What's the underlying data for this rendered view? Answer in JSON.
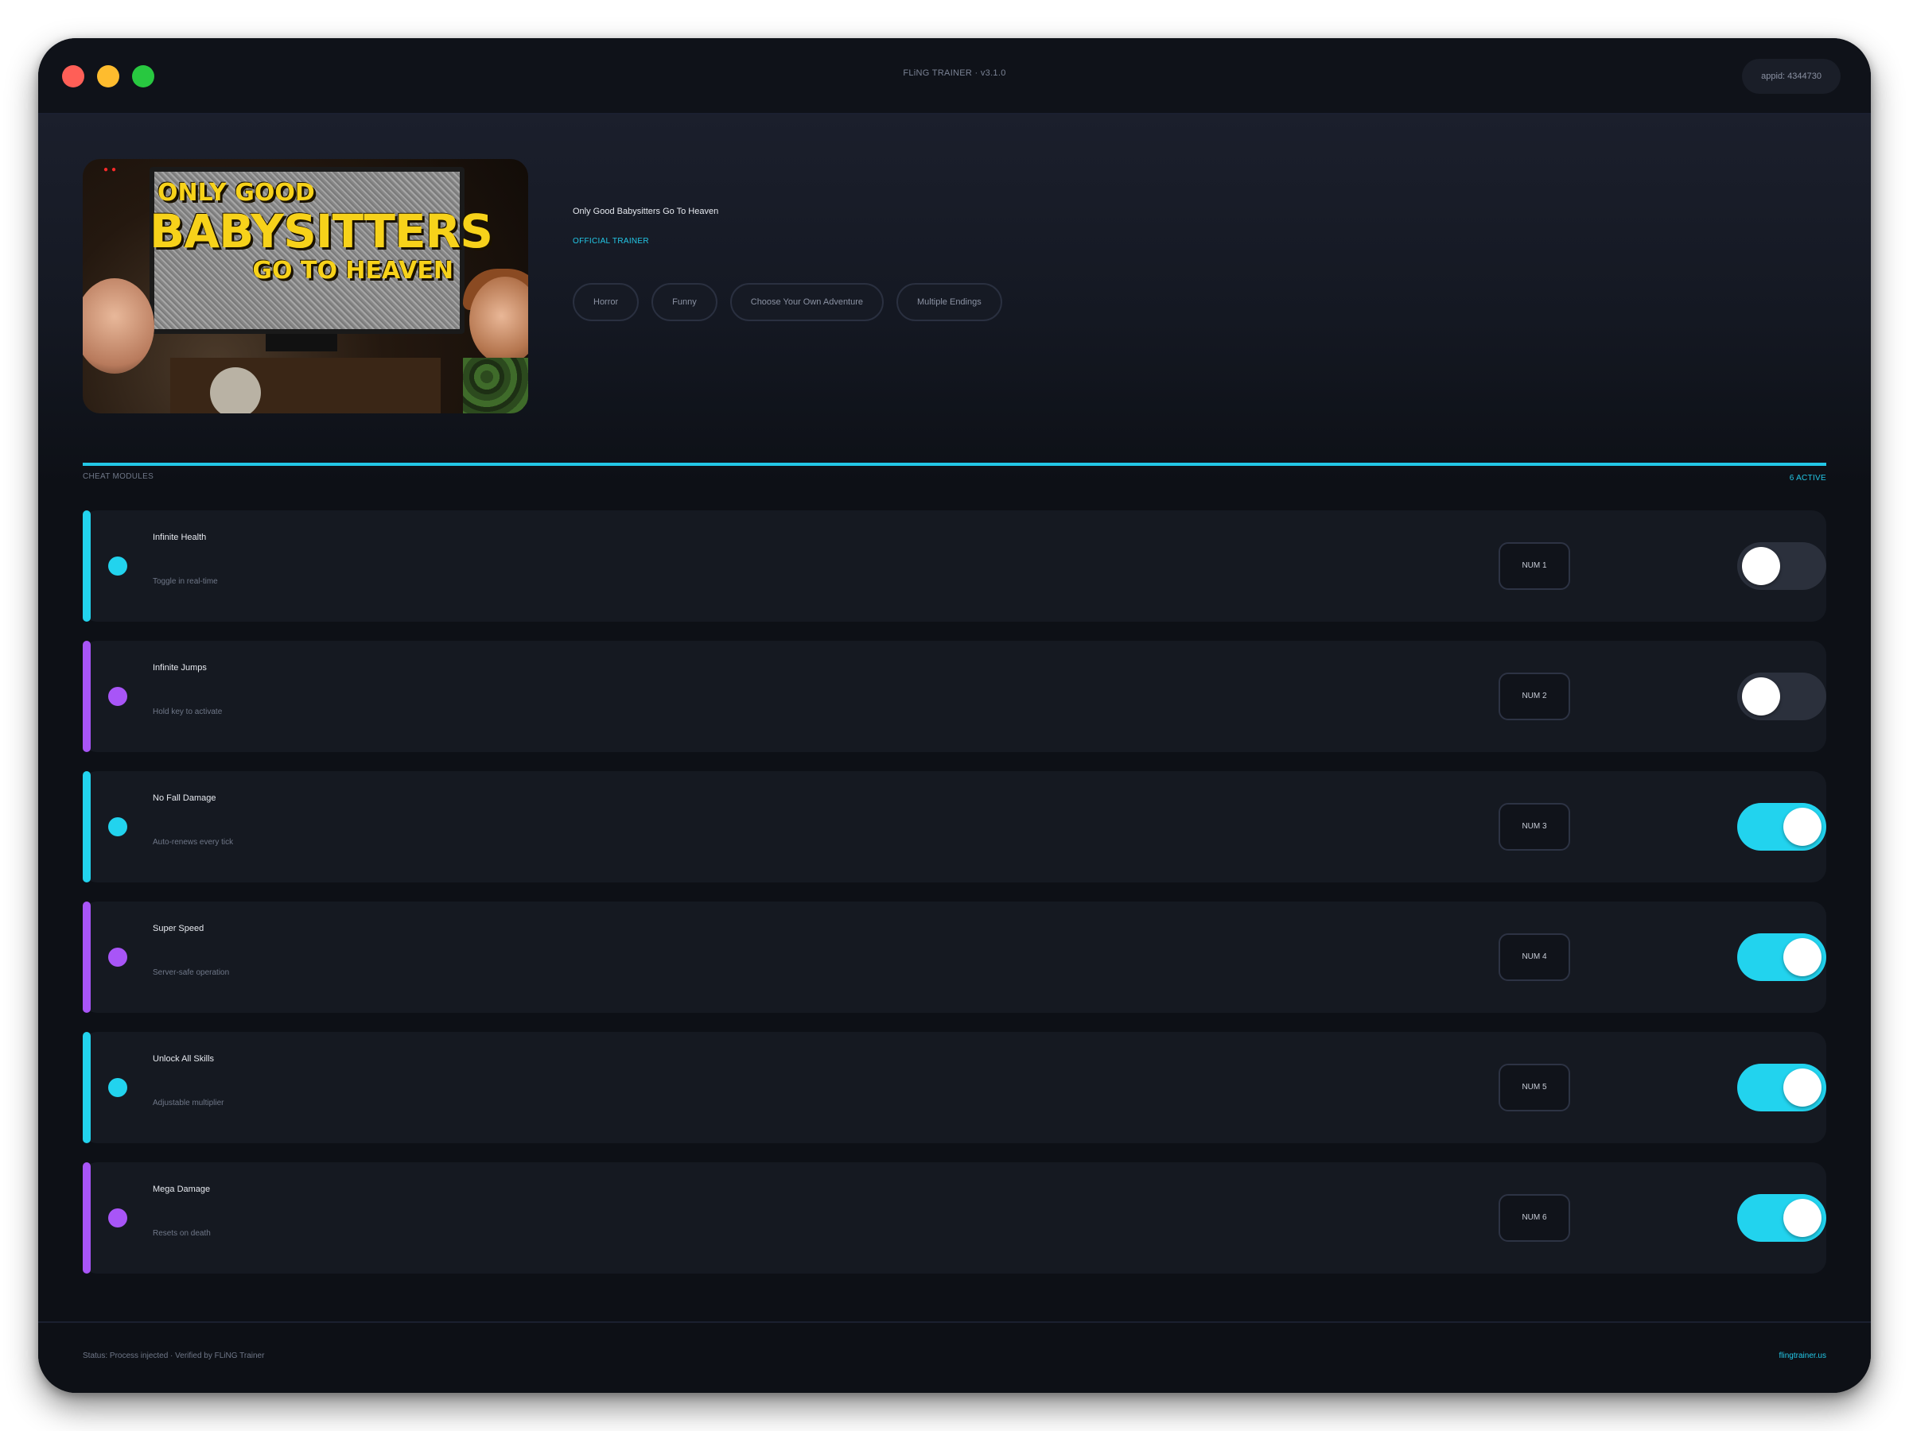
{
  "window": {
    "title": "FLiNG TRAINER · v3.1.0",
    "appid": "appid: 4344730"
  },
  "game": {
    "title": "Only Good Babysitters Go To Heaven",
    "badge": "OFFICIAL TRAINER",
    "cover_text": [
      "ONLY GOOD",
      "BABYSITTERS",
      "GO TO HEAVEN"
    ],
    "tags": [
      "Horror",
      "Funny",
      "Choose Your Own Adventure",
      "Multiple Endings"
    ]
  },
  "section": {
    "label": "CHEAT MODULES",
    "count": "6 ACTIVE"
  },
  "colors": {
    "cyan": "#22d3ee",
    "purple": "#a855f7",
    "toggle_off": "#2b303c"
  },
  "cheats": [
    {
      "name": "Infinite Health",
      "desc": "Toggle in real-time",
      "key": "NUM 1",
      "enabled": false,
      "accent": "cyan"
    },
    {
      "name": "Infinite Jumps",
      "desc": "Hold key to activate",
      "key": "NUM 2",
      "enabled": false,
      "accent": "purple"
    },
    {
      "name": "No Fall Damage",
      "desc": "Auto-renews every tick",
      "key": "NUM 3",
      "enabled": true,
      "accent": "cyan"
    },
    {
      "name": "Super Speed",
      "desc": "Server-safe operation",
      "key": "NUM 4",
      "enabled": true,
      "accent": "purple"
    },
    {
      "name": "Unlock All Skills",
      "desc": "Adjustable multiplier",
      "key": "NUM 5",
      "enabled": true,
      "accent": "cyan"
    },
    {
      "name": "Mega Damage",
      "desc": "Resets on death",
      "key": "NUM 6",
      "enabled": true,
      "accent": "purple"
    }
  ],
  "footer": {
    "status": "Status: Process injected · Verified by FLiNG Trainer",
    "link": "flingtrainer.us"
  }
}
